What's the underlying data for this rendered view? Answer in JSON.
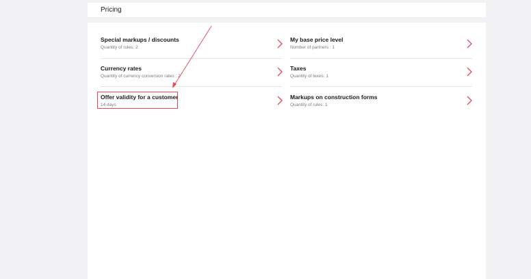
{
  "header": {
    "title": "Pricing"
  },
  "items": [
    {
      "title": "Special markups / discounts",
      "subtitle": "Quantity of rules: 2"
    },
    {
      "title": "My base price level",
      "subtitle": "Number of partners : 1"
    },
    {
      "title": "Currency rates",
      "subtitle": "Quantity of currency conversion rates : 2"
    },
    {
      "title": "Taxes",
      "subtitle": "Quantity of texes: 1"
    },
    {
      "title": "Offer validity for a customer",
      "subtitle": "14 days"
    },
    {
      "title": "Markups on construction forms",
      "subtitle": "Quantity of rules: 1"
    }
  ],
  "icons": {
    "chevron": "chevron-right-icon"
  },
  "colors": {
    "accent": "#e8465a",
    "background": "#f2f2f4",
    "panel": "#ffffff",
    "title_text": "#1a1a1a",
    "subtitle_text": "#7a7a7a"
  }
}
